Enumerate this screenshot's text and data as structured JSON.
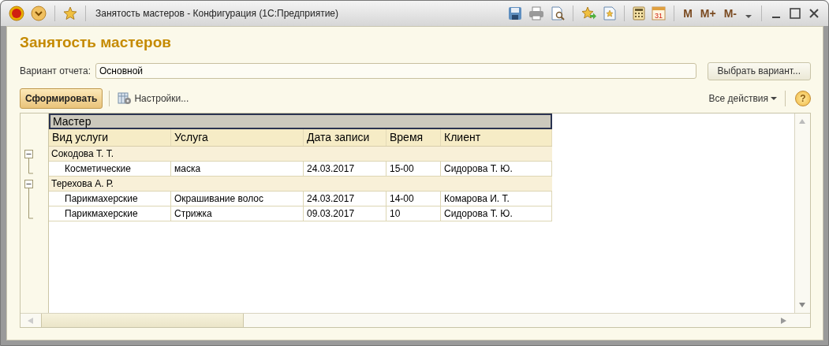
{
  "window": {
    "title": "Занятость мастеров - Конфигурация  (1С:Предприятие)",
    "calendar_day": "31",
    "memory_buttons": [
      "M",
      "M+",
      "M-"
    ]
  },
  "heading": "Занятость мастеров",
  "variant": {
    "label": "Вариант отчета:",
    "value": "Основной",
    "button": "Выбрать вариант..."
  },
  "toolbar": {
    "generate": "Сформировать",
    "settings": "Настройки...",
    "all_actions": "Все действия",
    "help": "?"
  },
  "report": {
    "group_header": "Мастер",
    "columns": [
      "Вид услуги",
      "Услуга",
      "Дата записи",
      "Время",
      "Клиент"
    ],
    "groups": [
      {
        "name": "Сокодова Т. Т.",
        "expanded": true,
        "rows": [
          [
            "Косметические",
            "маска",
            "24.03.2017",
            "15-00",
            "Сидорова Т. Ю."
          ]
        ]
      },
      {
        "name": "Терехова А. Р.",
        "expanded": true,
        "rows": [
          [
            "Парикмахерские",
            "Окрашивание волос",
            "24.03.2017",
            "14-00",
            "Комарова И. Т."
          ],
          [
            "Парикмахерские",
            "Стрижка",
            "09.03.2017",
            "10",
            "Сидорова Т. Ю."
          ]
        ]
      }
    ]
  }
}
